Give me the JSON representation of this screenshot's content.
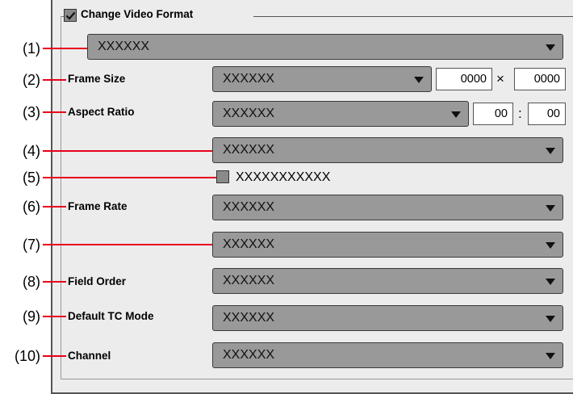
{
  "group": {
    "title": "Change Video Format",
    "checked": true
  },
  "rows": {
    "r1": {
      "num": "(1)",
      "value": "XXXXXX"
    },
    "r2": {
      "num": "(2)",
      "label": "Frame Size",
      "value": "XXXXXX",
      "width": "0000",
      "sep": "×",
      "height": "0000"
    },
    "r3": {
      "num": "(3)",
      "label": "Aspect Ratio",
      "value": "XXXXXX",
      "ratio_w": "00",
      "sep": ":",
      "ratio_h": "00"
    },
    "r4": {
      "num": "(4)",
      "value": "XXXXXX"
    },
    "r5": {
      "num": "(5)",
      "checkbox_label": "XXXXXXXXXXX",
      "checked": false
    },
    "r6": {
      "num": "(6)",
      "label": "Frame Rate",
      "value": "XXXXXX"
    },
    "r7": {
      "num": "(7)",
      "value": "XXXXXX"
    },
    "r8": {
      "num": "(8)",
      "label": "Field Order",
      "value": "XXXXXX"
    },
    "r9": {
      "num": "(9)",
      "label": "Default TC Mode",
      "value": "XXXXXX"
    },
    "r10": {
      "num": "(10)",
      "label": "Channel",
      "value": "XXXXXX"
    }
  },
  "icons": {
    "check": "checkmark-icon",
    "dropdown": "chevron-down-icon"
  },
  "colors": {
    "panel": "#ececec",
    "combo": "#999999",
    "leader": "#e8001c"
  }
}
